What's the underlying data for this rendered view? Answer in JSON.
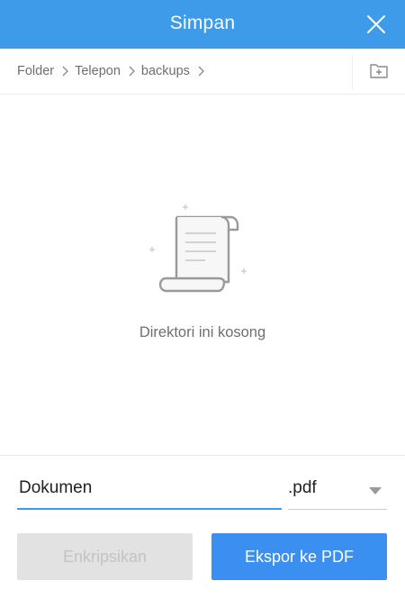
{
  "dialog": {
    "title": "Simpan"
  },
  "breadcrumb": {
    "items": [
      {
        "label": "Folder"
      },
      {
        "label": "Telepon"
      },
      {
        "label": "backups"
      }
    ]
  },
  "empty_state": {
    "message": "Direktori ini kosong",
    "icon": "document-scroll-icon"
  },
  "form": {
    "filename_value": "Dokumen",
    "extension_value": ".pdf",
    "encrypt_label": "Enkripsikan",
    "export_label": "Ekspor ke PDF"
  },
  "colors": {
    "header": "#3d9be9",
    "primary_button": "#3a8ff0",
    "disabled_button": "#e2e2e2",
    "accent_underline": "#3d9be9"
  }
}
